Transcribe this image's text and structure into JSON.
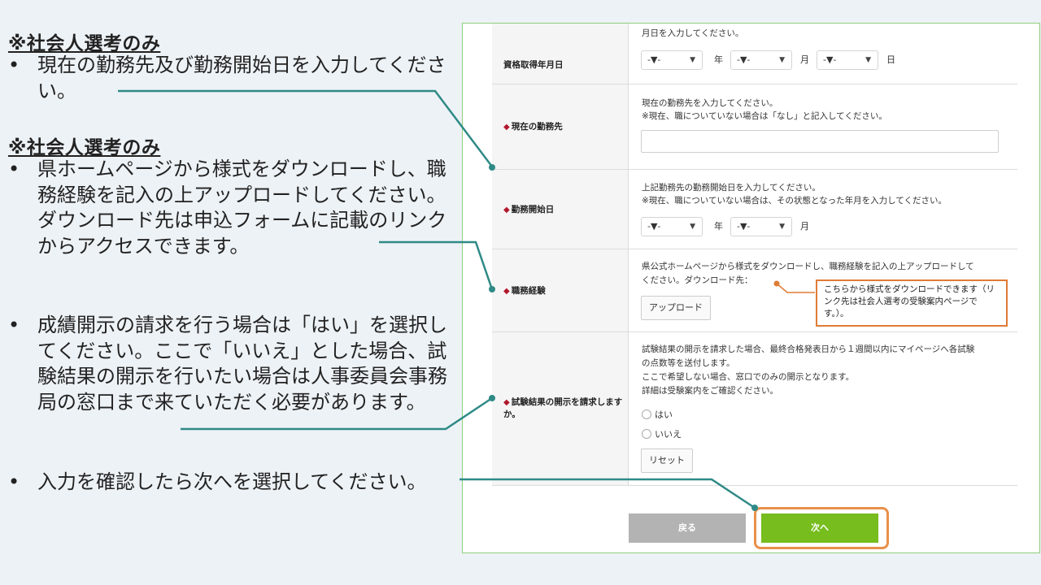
{
  "notes": {
    "section1_title": "※社会人選考のみ",
    "bullet": "•",
    "n1": "現在の勤務先及び勤務開始日を入力してください。",
    "section2_title": "※社会人選考のみ",
    "n2": "県ホームページから様式をダウンロードし、職務経験を記入の上アップロードしてください。ダウンロード先は申込フォームに記載のリンクからアクセスできます。",
    "n3": "成績開示の請求を行う場合は「はい」を選択してください。ここで「いいえ」とした場合、試験結果の開示を行いたい場合は人事委員会事務局の窓口まで来ていただく必要があります。",
    "n4": "入力を確認したら次へを選択してください。"
  },
  "form": {
    "diamond": "◆",
    "qualification": {
      "label": "資格取得年月日",
      "help": "月日を入力してください。",
      "year_value": "-▼-",
      "year_unit": "年",
      "month_value": "-▼-",
      "month_unit": "月",
      "day_value": "-▼-",
      "day_unit": "日"
    },
    "employer": {
      "label": "現在の勤務先",
      "help1": "現在の勤務先を入力してください。",
      "help2": "※現在、職についていない場合は「なし」と記入してください。",
      "value": ""
    },
    "start_date": {
      "label": "勤務開始日",
      "help1": "上記勤務先の勤務開始日を入力してください。",
      "help2": "※現在、職についていない場合は、その状態となった年月を入力してください。",
      "year_value": "-▼-",
      "year_unit": "年",
      "month_value": "-▼-",
      "month_unit": "月"
    },
    "experience": {
      "label": "職務経験",
      "help1": "県公式ホームページから様式をダウンロードし、職務経験を記入の上アップロードして",
      "help2": "ください。ダウンロード先：",
      "upload_label": "アップロード",
      "callout": "こちらから様式をダウンロードできます（リンク先は社会人選考の受験案内ページです。）。"
    },
    "disclosure": {
      "label": "試験結果の開示を請求しますか。",
      "help1": "試験結果の開示を請求した場合、最終合格発表日から１週間以内にマイページへ各試験",
      "help2": "の点数等を送付します。",
      "help3": "ここで希望しない場合、窓口でのみの開示となります。",
      "help4": "詳細は受験案内をご確認ください。",
      "option_yes": "はい",
      "option_no": "いいえ",
      "reset_label": "リセット"
    },
    "back_label": "戻る",
    "next_label": "次へ"
  },
  "colors": {
    "connector": "#2f8a86",
    "callout_border": "#e07b35",
    "next_green": "#76bd1d",
    "diamond_red": "#b3172c"
  }
}
